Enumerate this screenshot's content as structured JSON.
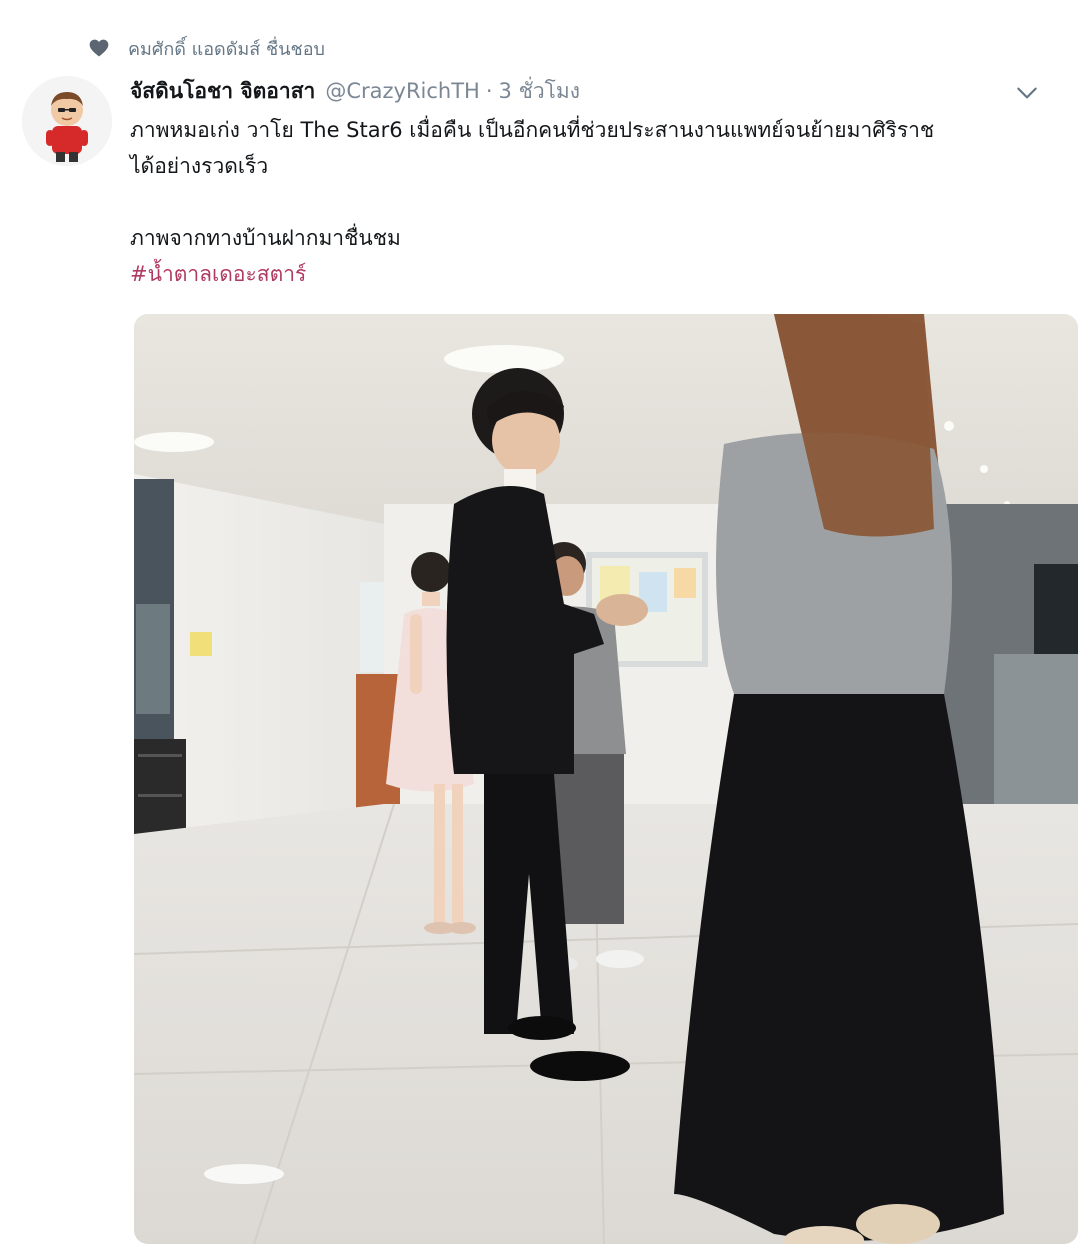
{
  "social_context": {
    "icon": "heart-icon",
    "text": "คมศักดิ์ แอดดัมส์ ชื่นชอบ"
  },
  "tweet": {
    "author": {
      "display_name": "จัสดินโอชา จิตอาสา",
      "handle": "@CrazyRichTH",
      "separator": "·",
      "time": "3 ชั่วโมง",
      "avatar_icon": "avatar-cartoon"
    },
    "text_line1": "ภาพหมอเก่ง วาโย The Star6 เมื่อคืน เป็นอีกคนที่ช่วยประสานงานแพทย์จนย้ายมาศิริราช",
    "text_line2": "ได้อย่างรวดเร็ว",
    "text_line3": "ภาพจากทางบ้านฝากมาชื่นชม",
    "hashtag": "#น้ำตาลเดอะสตาร์",
    "menu_icon": "chevron-down-icon",
    "media_kind": "photo"
  },
  "colors": {
    "text": "#14171a",
    "secondary": "#657786",
    "hashtag": "#b03a63",
    "heart": "#5b6672"
  }
}
